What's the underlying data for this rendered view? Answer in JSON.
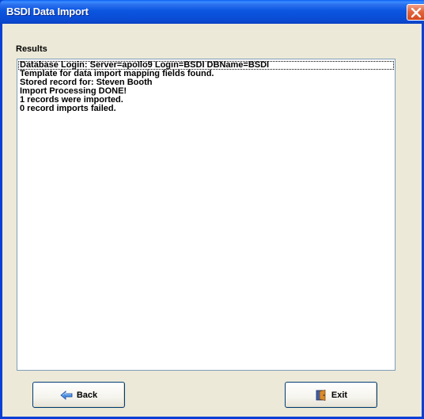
{
  "window": {
    "title": "BSDI Data Import"
  },
  "results": {
    "label": "Results",
    "lines": [
      "Database Login: Server=apollo9  Login=BSDI  DBName=BSDI",
      "Template for data import mapping fields found.",
      "Stored record for: Steven Booth",
      "Import Processing DONE!",
      "1 records were imported.",
      "0 record imports failed."
    ]
  },
  "buttons": {
    "back_label": "Back",
    "exit_label": "Exit"
  },
  "icons": {
    "close": "close-icon",
    "back": "back-arrow-icon",
    "exit": "exit-door-icon"
  },
  "colors": {
    "titlebar": "#0a56e0",
    "close": "#e2663e",
    "client": "#ece9d8",
    "results_border": "#7f9db9",
    "button_border": "#003c74"
  }
}
